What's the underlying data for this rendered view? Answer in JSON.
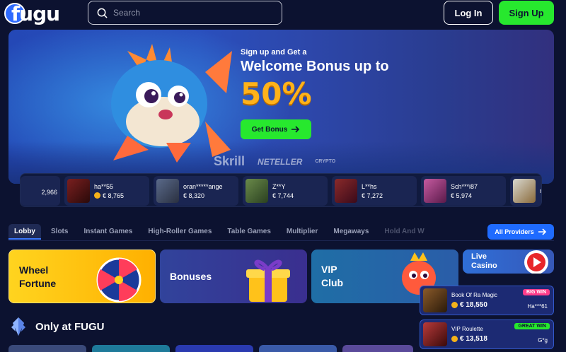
{
  "header": {
    "logo_text": "fugu",
    "search_placeholder": "Search",
    "login_label": "Log In",
    "signup_label": "Sign Up"
  },
  "hero": {
    "pretitle": "Sign up and Get a",
    "headline": "Welcome Bonus up to",
    "percent": "50%",
    "cta_label": "Get Bonus",
    "payments": [
      "Skrill",
      "NETELLER",
      "CRYPTO"
    ]
  },
  "recent_wins": [
    {
      "user": "",
      "amount": "2,966"
    },
    {
      "user": "ha**55",
      "amount": "€ 8,765"
    },
    {
      "user": "oran*****ange",
      "amount": "€ 8,320"
    },
    {
      "user": "Z**Y",
      "amount": "€ 7,744"
    },
    {
      "user": "L**hs",
      "amount": "€ 7,272"
    },
    {
      "user": "Sch***i87",
      "amount": "€ 5,974"
    },
    {
      "user": "n*",
      "amount": ""
    }
  ],
  "tabs": [
    "Lobby",
    "Slots",
    "Instant Games",
    "High-Roller Games",
    "Table Games",
    "Multiplier",
    "Megaways",
    "Hold And W"
  ],
  "all_providers_label": "All Providers",
  "categories": {
    "wheel": "Wheel Fortune",
    "bonuses": "Bonuses",
    "vip": "VIP Club",
    "live": "Live Casino"
  },
  "section_title": "Only at FUGU",
  "big_wins": [
    {
      "game": "Book Of Ra Magic",
      "amount": "€ 18,550",
      "badge": "BIG WIN",
      "user": "Ha***61",
      "badge_color": "#ff3d8b"
    },
    {
      "game": "VIP Roulette",
      "amount": "€ 13,518",
      "badge": "GREAT WIN",
      "user": "G*g",
      "badge_color": "#27e82e"
    }
  ],
  "colors": {
    "accent_green": "#27e82e",
    "accent_blue": "#1f6bff",
    "background": "#0c1230",
    "bonus_orange": "#ffb21a"
  }
}
